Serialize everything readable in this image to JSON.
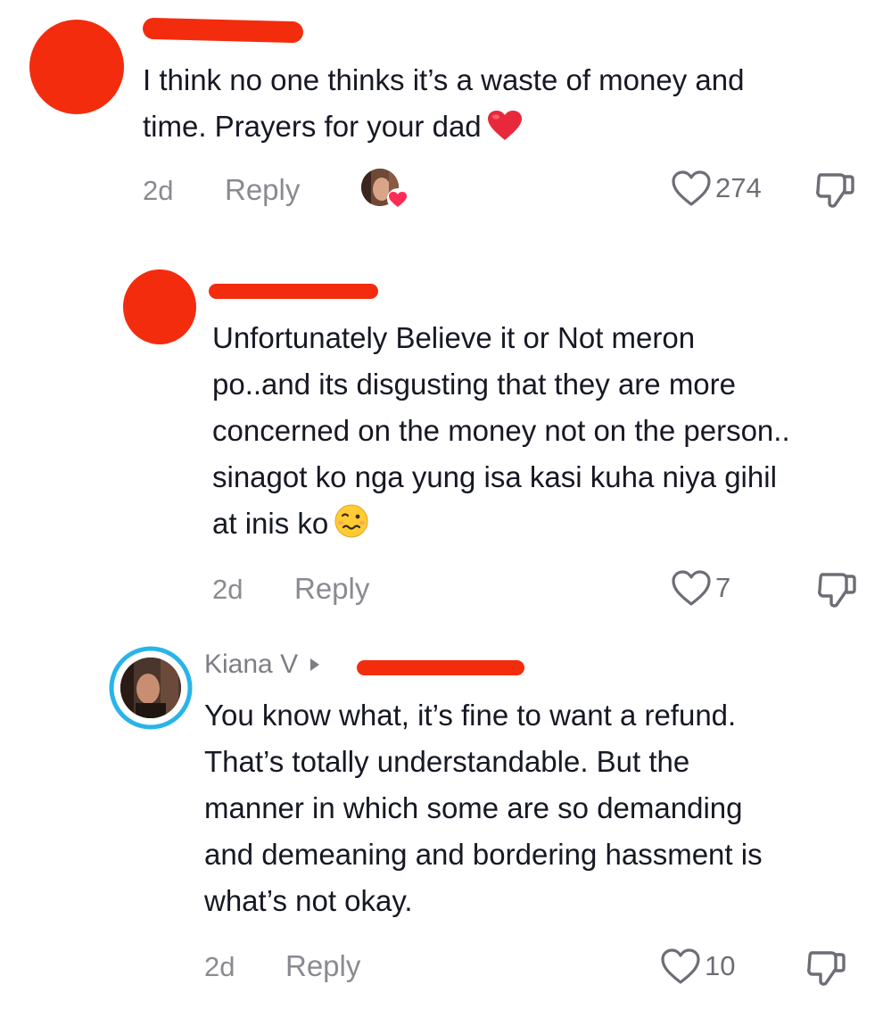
{
  "comments": [
    {
      "text_lines": [
        "I think no one thinks it’s a waste of money and",
        "time. Prayers for your dad"
      ],
      "age": "2d",
      "reply_label": "Reply",
      "likes": "274",
      "emoji": "red-heart"
    },
    {
      "text_lines": [
        "Unfortunately Believe it or Not meron",
        "po..and its disgusting that they are more",
        "concerned on the money not on the person..",
        "sinagot ko nga yung isa kasi kuha niya gihil",
        "at inis ko"
      ],
      "age": "2d",
      "reply_label": "Reply",
      "likes": "7",
      "emoji": "woozy-face"
    },
    {
      "username": "Kiana V",
      "text_lines": [
        "You know what, it’s fine to want a refund.",
        "That’s totally understandable. But the",
        "manner in which some are so demanding",
        "and demeaning and bordering hassment is",
        "what’s not okay."
      ],
      "age": "2d",
      "reply_label": "Reply",
      "likes": "10"
    }
  ],
  "colors": {
    "redaction": "#f42c0e",
    "text": "#161823",
    "muted": "#8a8b91",
    "heart_emoji": "#e8293c",
    "avatar_ring": "#28b4e8"
  }
}
